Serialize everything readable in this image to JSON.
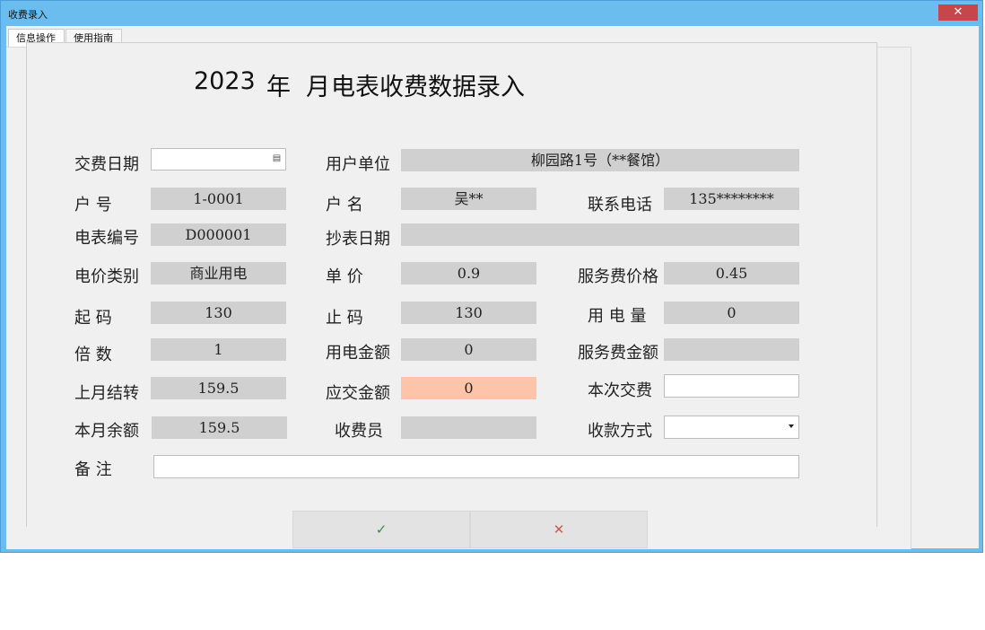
{
  "window": {
    "title": "收费录入",
    "close_glyph": "✕"
  },
  "tabs": [
    {
      "label": "信息操作"
    },
    {
      "label": "使用指南"
    }
  ],
  "heading": {
    "year": "2023",
    "year_unit": "年",
    "month_unit": "月",
    "title": "电表收费数据录入"
  },
  "fields": {
    "pay_date": {
      "label": "交费日期",
      "value": ""
    },
    "user_unit": {
      "label": "用户单位",
      "value": "柳园路1号（**餐馆）"
    },
    "account_no": {
      "label": "户  号",
      "value": "1-0001"
    },
    "account_name": {
      "label": "户  名",
      "value": "吴**"
    },
    "phone": {
      "label": "联系电话",
      "value": "135********"
    },
    "meter_no": {
      "label": "电表编号",
      "value": "D000001"
    },
    "read_date": {
      "label": "抄表日期",
      "value": ""
    },
    "price_category": {
      "label": "电价类别",
      "value": "商业用电"
    },
    "unit_price": {
      "label": "单  价",
      "value": "0.9"
    },
    "service_price": {
      "label": "服务费价格",
      "value": "0.45"
    },
    "start_reading": {
      "label": "起  码",
      "value": "130"
    },
    "end_reading": {
      "label": "止  码",
      "value": "130"
    },
    "usage": {
      "label": "用 电 量",
      "value": "0"
    },
    "multiplier": {
      "label": "倍  数",
      "value": "1"
    },
    "power_amount": {
      "label": "用电金额",
      "value": "0"
    },
    "service_amount": {
      "label": "服务费金额",
      "value": ""
    },
    "last_balance": {
      "label": "上月结转",
      "value": "159.5"
    },
    "amount_due": {
      "label": "应交金额",
      "value": "0"
    },
    "this_payment": {
      "label": "本次交费",
      "value": ""
    },
    "month_balance": {
      "label": "本月余额",
      "value": "159.5"
    },
    "cashier": {
      "label": "收费员",
      "value": ""
    },
    "payment_method": {
      "label": "收款方式",
      "value": ""
    },
    "remark": {
      "label": "备  注",
      "value": ""
    }
  },
  "buttons": {
    "confirm": "✓",
    "cancel": "✕"
  },
  "colors": {
    "titlebar": "#6bbdf0",
    "close": "#c7464a",
    "readonly_field": "#d0d0d0",
    "highlight_field": "#fcc5a9",
    "confirm_icon": "#3d8a4a",
    "cancel_icon": "#d0584e"
  },
  "icons": {
    "pay_date": "calendar-icon",
    "payment_method": "chevron-down-icon"
  }
}
